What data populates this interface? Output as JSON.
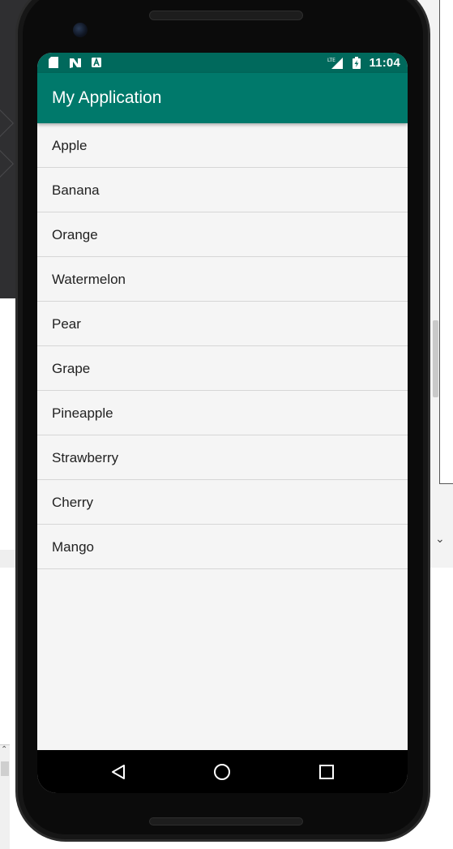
{
  "statusbar": {
    "time": "11:04",
    "icons": [
      "sd-card-icon",
      "n-logo-icon",
      "a-logo-icon",
      "lte-signal-icon",
      "battery-charging-icon"
    ],
    "lte_label": "LTE"
  },
  "appbar": {
    "title": "My Application"
  },
  "list": {
    "items": [
      {
        "label": "Apple"
      },
      {
        "label": "Banana"
      },
      {
        "label": "Orange"
      },
      {
        "label": "Watermelon"
      },
      {
        "label": "Pear"
      },
      {
        "label": "Grape"
      },
      {
        "label": "Pineapple"
      },
      {
        "label": "Strawberry"
      },
      {
        "label": "Cherry"
      },
      {
        "label": "Mango"
      }
    ]
  },
  "navbar": {
    "buttons": [
      "back-icon",
      "home-icon",
      "recents-icon"
    ]
  },
  "colors": {
    "statusbar": "#00695c",
    "appbar": "#00796b",
    "list_background": "#f5f5f5",
    "divider": "#d6d6d6"
  }
}
